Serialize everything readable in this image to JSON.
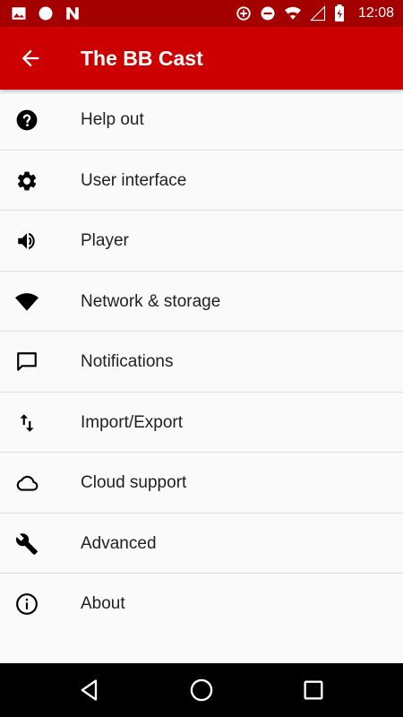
{
  "status_bar": {
    "time": "12:08",
    "left_icons": [
      "image-icon",
      "circle-icon",
      "n-logo-icon"
    ],
    "right_icons": [
      "data-saver-icon",
      "do-not-disturb-icon",
      "wifi-icon",
      "signal-icon",
      "battery-charging-icon"
    ]
  },
  "app_bar": {
    "title": "The BB Cast",
    "back_icon": "arrow-back-icon",
    "color": "#cc0000",
    "status_color": "#a50000"
  },
  "settings": {
    "items": [
      {
        "label": "Help out",
        "icon": "help-icon"
      },
      {
        "label": "User interface",
        "icon": "gear-icon"
      },
      {
        "label": "Player",
        "icon": "volume-icon"
      },
      {
        "label": "Network & storage",
        "icon": "wifi-icon"
      },
      {
        "label": "Notifications",
        "icon": "chat-bubble-icon"
      },
      {
        "label": "Import/Export",
        "icon": "import-export-icon"
      },
      {
        "label": "Cloud support",
        "icon": "cloud-icon"
      },
      {
        "label": "Advanced",
        "icon": "wrench-icon"
      },
      {
        "label": "About",
        "icon": "info-icon"
      }
    ]
  },
  "nav_bar": {
    "buttons": [
      "back-triangle-icon",
      "home-circle-icon",
      "recents-square-icon"
    ]
  }
}
